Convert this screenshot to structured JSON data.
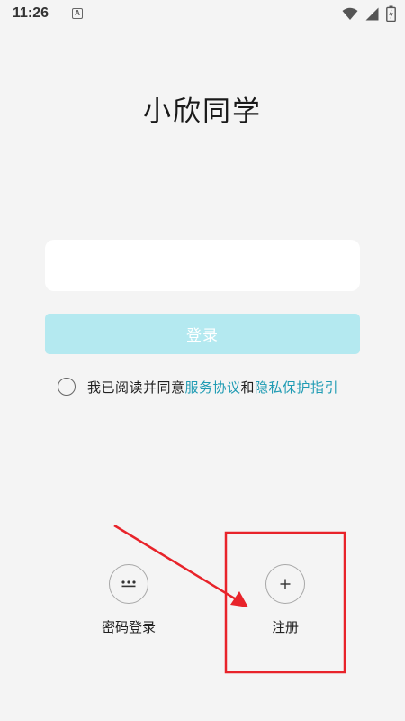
{
  "status_bar": {
    "time": "11:26",
    "notification_letter": "A"
  },
  "app": {
    "title": "小欣同学"
  },
  "login_form": {
    "input_value": "",
    "login_label": "登录"
  },
  "agreement": {
    "prefix": "我已阅读并同意",
    "service_link": "服务协议",
    "and_text": "和",
    "privacy_link": "隐私保护指引"
  },
  "options": {
    "password_login_label": "密码登录",
    "register_label": "注册"
  },
  "colors": {
    "background": "#f4f4f4",
    "login_button": "#b4e9f0",
    "link": "#1f9bb3",
    "annotation": "#e8232a"
  }
}
